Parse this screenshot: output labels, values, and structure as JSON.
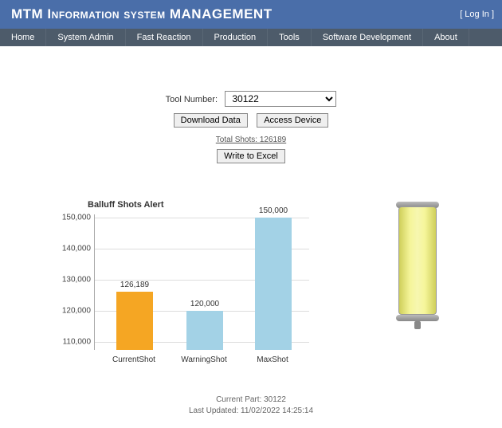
{
  "header": {
    "title": "MTM Information system MANAGEMENT",
    "login": "[ Log In ]"
  },
  "nav": [
    "Home",
    "System Admin",
    "Fast Reaction",
    "Production",
    "Tools",
    "Software Development",
    "About"
  ],
  "form": {
    "tool_label": "Tool Number:",
    "tool_value": "30122",
    "download": "Download Data",
    "access": "Access Device",
    "total_shots": "Total Shots: 126189",
    "write_excel": "Write to Excel"
  },
  "chart_data": {
    "type": "bar",
    "title": "Balluff Shots Alert",
    "categories": [
      "CurrentShot",
      "WarningShot",
      "MaxShot"
    ],
    "values": [
      126189,
      120000,
      150000
    ],
    "value_labels": [
      "126,189",
      "120,000",
      "150,000"
    ],
    "colors": [
      "#f5a623",
      "#a3d2e6",
      "#a3d2e6"
    ],
    "yticks": [
      110000,
      120000,
      130000,
      140000,
      150000
    ],
    "ytick_labels": [
      "110,000",
      "120,000",
      "130,000",
      "140,000",
      "150,000"
    ],
    "ylim": [
      107500,
      151000
    ]
  },
  "footer": {
    "part": "Current Part: 30122",
    "updated": "Last Updated: 11/02/2022 14:25:14"
  }
}
